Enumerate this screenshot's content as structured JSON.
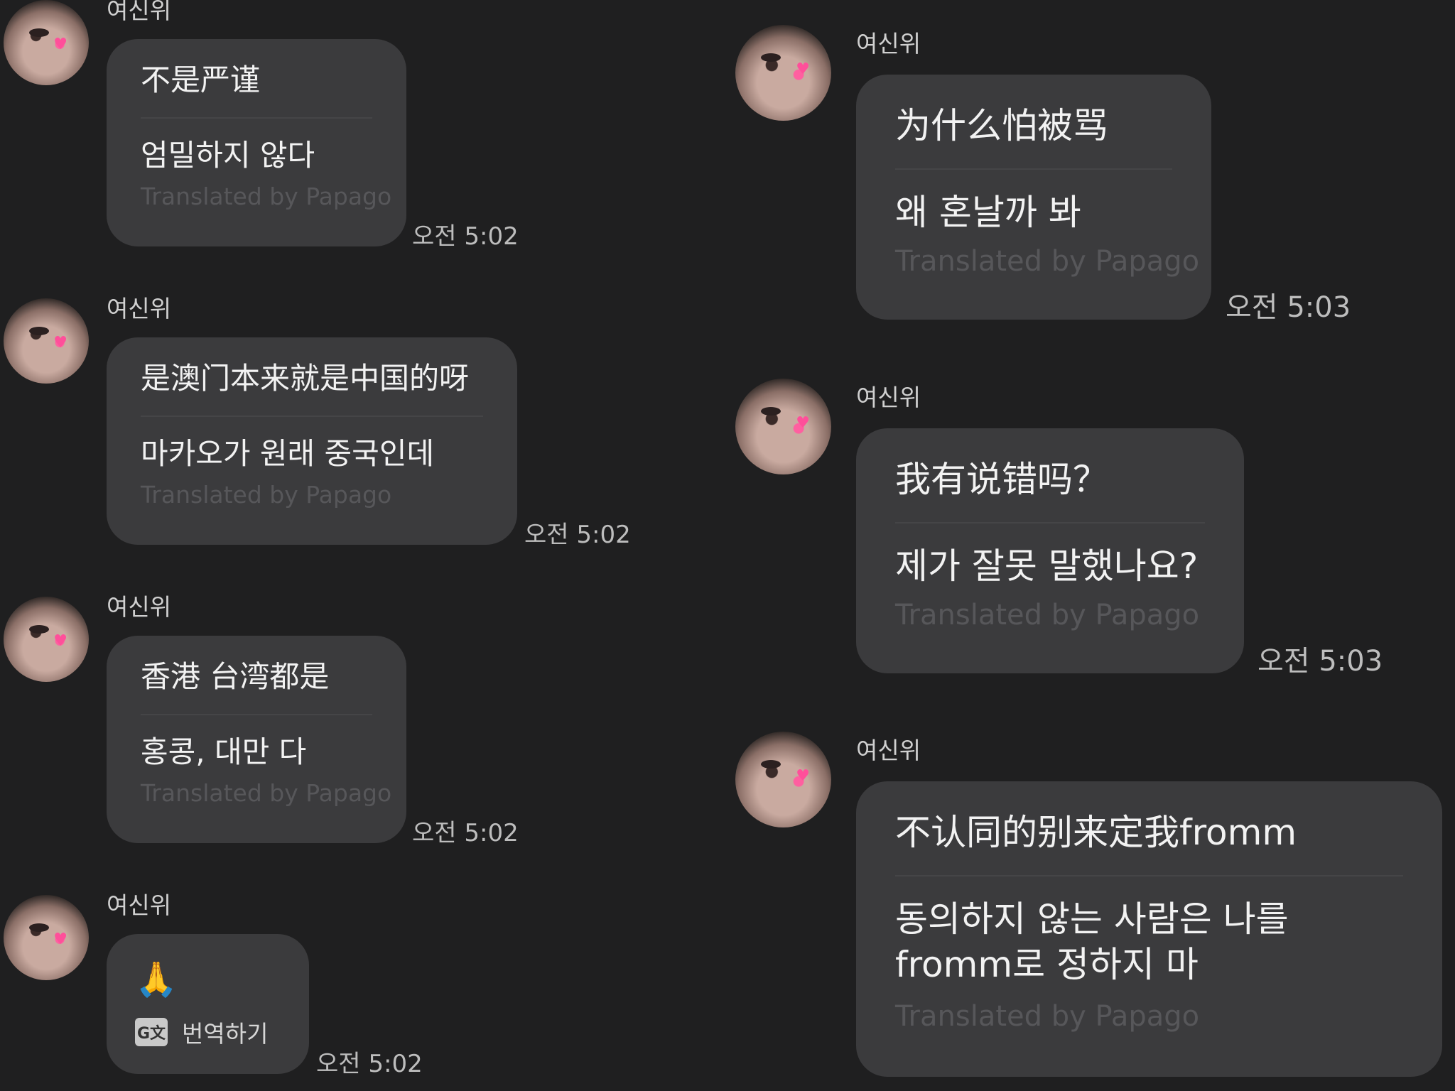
{
  "sender_name": "여신위",
  "credit": "Translated by Papago",
  "left": [
    {
      "zh": "不是严谨",
      "ko": "엄밀하지 않다",
      "time": "오전 5:02"
    },
    {
      "zh": "是澳门本来就是中国的呀",
      "ko": "마카오가 원래 중국인데",
      "time": "오전 5:02"
    },
    {
      "zh": "香港 台湾都是",
      "ko": "홍콩, 대만 다",
      "time": "오전 5:02"
    }
  ],
  "left_last": {
    "emoji": "🙏",
    "translate_label": "번역하기",
    "time": "오전 5:02"
  },
  "right": [
    {
      "zh": "为什么怕被骂",
      "ko": "왜 혼날까 봐",
      "time": "오전 5:03"
    },
    {
      "zh": "我有说错吗？",
      "ko": "제가 잘못 말했나요?",
      "time": "오전 5:03"
    },
    {
      "zh": "不认同的别来定我fromm",
      "ko_1": "동의하지 않는 사람은 나를",
      "ko_2": "fromm로 정하지 마"
    }
  ]
}
